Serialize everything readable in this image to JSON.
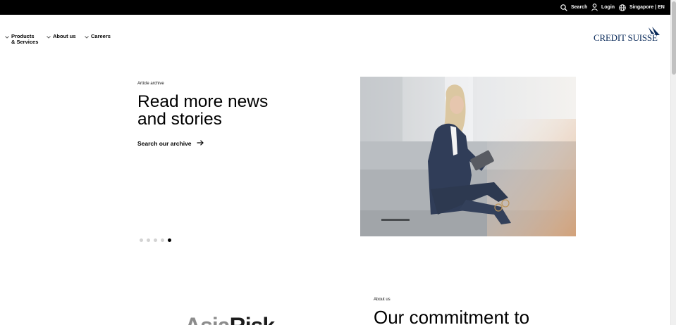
{
  "topbar": {
    "search_label": "Search",
    "login_label": "Login",
    "locale_label": "Singapore | EN",
    "icons": [
      "search-icon",
      "user-icon",
      "globe-icon"
    ]
  },
  "nav": {
    "products_line1": "Products",
    "products_line2": "& Services",
    "about_label": "About us",
    "careers_label": "Careers"
  },
  "logo": {
    "text": "CREDIT SUISSE",
    "color": "#0a2a5a"
  },
  "hero": {
    "eyebrow": "Article archive",
    "title_line1": "Read more news",
    "title_line2": "and stories",
    "link_label": "Search our archive",
    "slides_total": 5,
    "active_slide": 5,
    "image_description_icon": "photo"
  },
  "lower": {
    "eyebrow": "About us",
    "title": "Our commitment to",
    "logo_text_1": "Asia",
    "logo_text_2": "Risk"
  }
}
